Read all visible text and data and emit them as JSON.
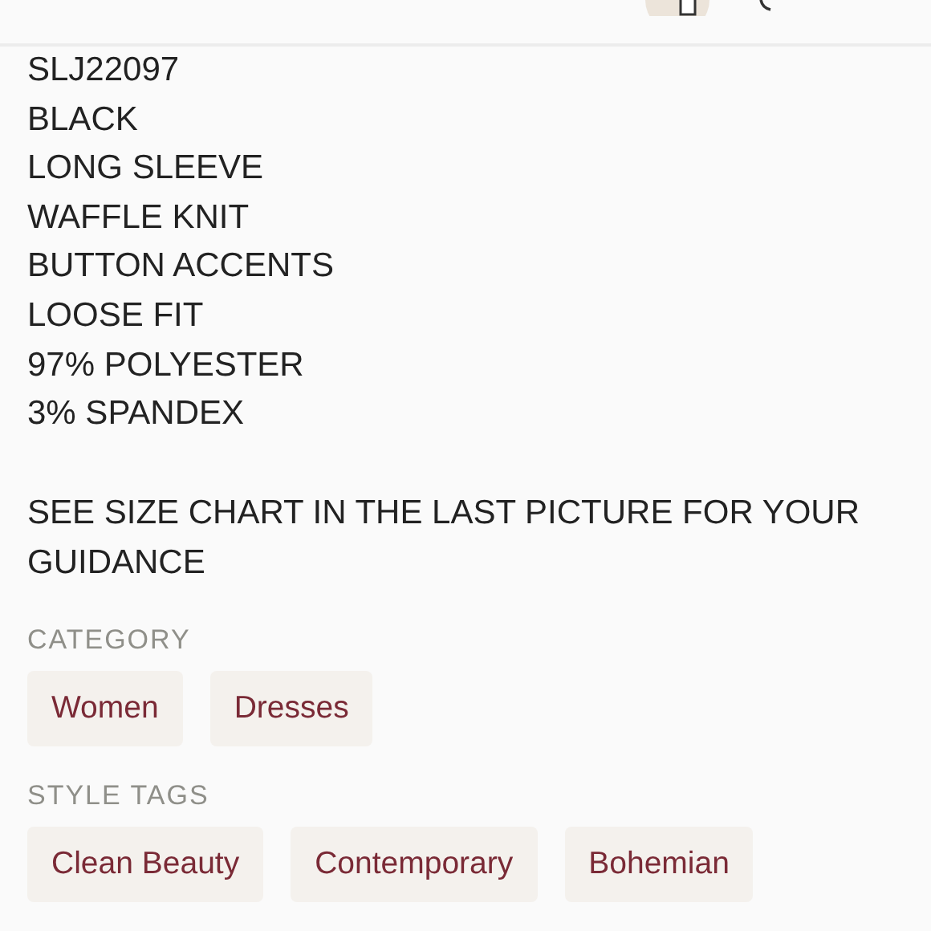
{
  "description_lines": [
    "SLJ22097",
    "BLACK",
    "LONG SLEEVE",
    "WAFFLE KNIT",
    "BUTTON ACCENTS",
    "LOOSE FIT",
    "97% POLYESTER",
    "3% SPANDEX"
  ],
  "note": "SEE SIZE CHART IN THE LAST PICTURE FOR YOUR GUIDANCE",
  "sections": [
    {
      "heading": "CATEGORY",
      "tags": [
        "Women",
        "Dresses"
      ]
    },
    {
      "heading": "STYLE TAGS",
      "tags": [
        "Clean Beauty",
        "Contemporary",
        "Bohemian"
      ]
    }
  ]
}
